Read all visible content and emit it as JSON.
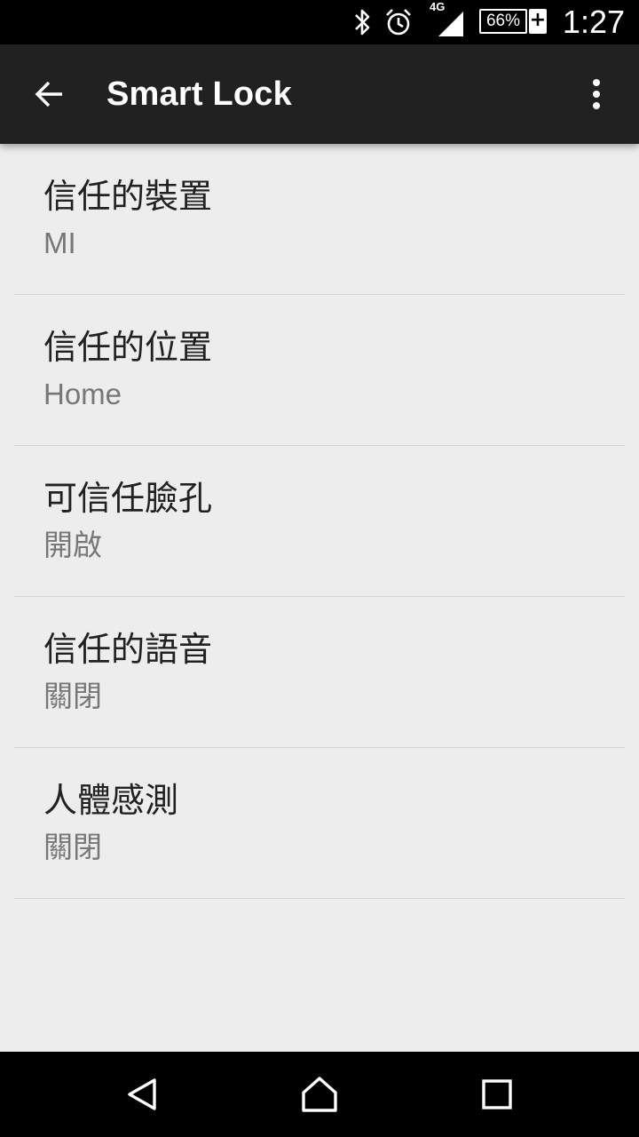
{
  "status_bar": {
    "network_type": "4G",
    "battery_percent": "66%",
    "time": "1:27",
    "icons": [
      "bluetooth-icon",
      "alarm-icon",
      "signal-icon",
      "battery-charging-icon"
    ]
  },
  "app_bar": {
    "title": "Smart Lock",
    "back_icon": "arrow-back-icon",
    "overflow_icon": "more-vert-icon"
  },
  "settings": {
    "items": [
      {
        "title": "信任的裝置",
        "summary": "MI"
      },
      {
        "title": "信任的位置",
        "summary": "Home"
      },
      {
        "title": "可信任臉孔",
        "summary": "開啟"
      },
      {
        "title": "信任的語音",
        "summary": "關閉"
      },
      {
        "title": "人體感測",
        "summary": "關閉"
      }
    ]
  },
  "nav_bar": {
    "icons": [
      "back-triangle-icon",
      "home-icon",
      "recents-square-icon"
    ]
  },
  "colors": {
    "status_bar_bg": "#000000",
    "app_bar_bg": "#212121",
    "page_bg": "#ededed",
    "title_text": "#212121",
    "summary_text": "#777777",
    "divider": "#d4d4d4"
  }
}
